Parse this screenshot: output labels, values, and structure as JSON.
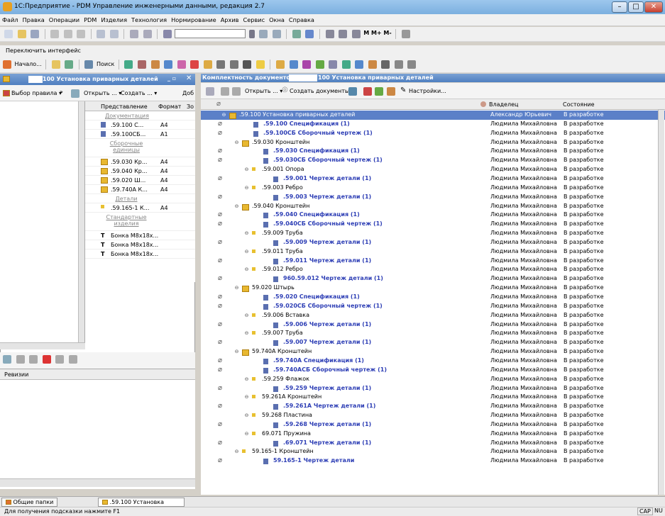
{
  "window": {
    "title": "1С:Предприятие - PDM Управление инженерными данными, редакция 2.7"
  },
  "menu": [
    "Файл",
    "Правка",
    "Операции",
    "PDM",
    "Изделия",
    "Технология",
    "Нормирование",
    "Архив",
    "Сервис",
    "Окна",
    "Справка"
  ],
  "toolbar2": {
    "m_labels": "M  M+  M-"
  },
  "interface_switch": "Переключить интерфейс",
  "toolbar3": {
    "start": "Начало...",
    "search": "Поиск"
  },
  "left_panel": {
    "title": "100 Установка приварных деталей",
    "rule_button": "Выбор правила",
    "open_button": "Открыть ...",
    "create_button": "Создать ...",
    "more_button": "Доб",
    "tree": [
      ".59.100",
      ".59",
      ".59",
      ".59.0",
      ".59.0",
      ".59",
      ".59.7"
    ],
    "grid_headers": [
      "Представление",
      "Формат",
      "Зо"
    ],
    "grid": [
      {
        "kind": "group",
        "text": "Документация"
      },
      {
        "kind": "doc",
        "text": ".59.100 С...",
        "fmt": "A4"
      },
      {
        "kind": "doc",
        "text": ".59.100СБ...",
        "fmt": "A1"
      },
      {
        "kind": "group",
        "text": "Сборочные единицы"
      },
      {
        "kind": "folder",
        "text": ".59.030 Кр...",
        "fmt": "A4"
      },
      {
        "kind": "folder",
        "text": ".59.040 Кр...",
        "fmt": "A4"
      },
      {
        "kind": "folder",
        "text": ".59.020 Ш...",
        "fmt": "A4"
      },
      {
        "kind": "folder",
        "text": ".59.740А К...",
        "fmt": "A4"
      },
      {
        "kind": "group",
        "text": "Детали"
      },
      {
        "kind": "part",
        "text": ".59.165-1 К...",
        "fmt": "A4"
      },
      {
        "kind": "group",
        "text": "Стандартные изделия"
      },
      {
        "kind": "std",
        "text": "Бонка М8х18х...",
        "fmt": ""
      },
      {
        "kind": "std",
        "text": "Бонка М8х18х...",
        "fmt": ""
      },
      {
        "kind": "std",
        "text": "Бонка М8х18х...",
        "fmt": ""
      }
    ],
    "revisions_header": "Ревизии"
  },
  "right_panel": {
    "title_prefix": "Комплектность документов:",
    "title_suffix": "100 Установка приварных деталей",
    "open_button": "Открыть ...",
    "create_docs": "Создать документы",
    "settings": "Настройки...",
    "col_owner": "Владелец",
    "col_state": "Состояние",
    "rows": [
      {
        "lvl": 0,
        "t": "folder",
        "clip": false,
        "sel": true,
        "name": ".59.100 Установка приварных деталей",
        "owner": "Александр Юрьевич",
        "state": "В разработке"
      },
      {
        "lvl": 1,
        "t": "doc",
        "clip": true,
        "name": ".59.100 Спецификация (1)",
        "owner": "Людмила Михайловна",
        "state": "В разработке"
      },
      {
        "lvl": 1,
        "t": "doc",
        "clip": true,
        "name": ".59.100СБ Сборочный чертеж (1)",
        "owner": "Людмила Михайловна",
        "state": "В разработке"
      },
      {
        "lvl": 1,
        "t": "folder",
        "clip": false,
        "name": ".59.030 Кронштейн",
        "owner": "Людмила Михайловна",
        "state": "В разработке"
      },
      {
        "lvl": 2,
        "t": "doc",
        "clip": true,
        "name": ".59.030 Спецификация (1)",
        "owner": "Людмила Михайловна",
        "state": "В разработке"
      },
      {
        "lvl": 2,
        "t": "doc",
        "clip": true,
        "name": ".59.030СБ Сборочный чертеж (1)",
        "owner": "Людмила Михайловна",
        "state": "В разработке"
      },
      {
        "lvl": 2,
        "t": "part",
        "clip": false,
        "name": ".59.001 Опора",
        "owner": "Людмила Михайловна",
        "state": "В разработке"
      },
      {
        "lvl": 3,
        "t": "doc",
        "clip": true,
        "name": ".59.001 Чертеж детали (1)",
        "owner": "Людмила Михайловна",
        "state": "В разработке"
      },
      {
        "lvl": 2,
        "t": "part",
        "clip": false,
        "name": ".59.003 Ребро",
        "owner": "Людмила Михайловна",
        "state": "В разработке"
      },
      {
        "lvl": 3,
        "t": "doc",
        "clip": true,
        "name": ".59.003 Чертеж детали (1)",
        "owner": "Людмила Михайловна",
        "state": "В разработке"
      },
      {
        "lvl": 1,
        "t": "folder",
        "clip": false,
        "name": ".59.040 Кронштейн",
        "owner": "Людмила Михайловна",
        "state": "В разработке"
      },
      {
        "lvl": 2,
        "t": "doc",
        "clip": true,
        "name": ".59.040 Спецификация (1)",
        "owner": "Людмила Михайловна",
        "state": "В разработке"
      },
      {
        "lvl": 2,
        "t": "doc",
        "clip": true,
        "name": ".59.040СБ Сборочный чертеж (1)",
        "owner": "Людмила Михайловна",
        "state": "В разработке"
      },
      {
        "lvl": 2,
        "t": "part",
        "clip": false,
        "name": ".59.009 Труба",
        "owner": "Людмила Михайловна",
        "state": "В разработке"
      },
      {
        "lvl": 3,
        "t": "doc",
        "clip": true,
        "name": ".59.009 Чертеж детали (1)",
        "owner": "Людмила Михайловна",
        "state": "В разработке"
      },
      {
        "lvl": 2,
        "t": "part",
        "clip": false,
        "name": ".59.011 Труба",
        "owner": "Людмила Михайловна",
        "state": "В разработке"
      },
      {
        "lvl": 3,
        "t": "doc",
        "clip": true,
        "name": ".59.011 Чертеж детали (1)",
        "owner": "Людмила Михайловна",
        "state": "В разработке"
      },
      {
        "lvl": 2,
        "t": "part",
        "clip": false,
        "name": ".59.012 Ребро",
        "owner": "Людмила Михайловна",
        "state": "В разработке"
      },
      {
        "lvl": 3,
        "t": "doc",
        "clip": true,
        "name": "960.59.012 Чертеж детали (1)",
        "owner": "Людмила Михайловна",
        "state": "В разработке"
      },
      {
        "lvl": 1,
        "t": "folder",
        "clip": false,
        "name": "59.020 Штырь",
        "owner": "Людмила Михайловна",
        "state": "В разработке"
      },
      {
        "lvl": 2,
        "t": "doc",
        "clip": true,
        "name": ".59.020 Спецификация (1)",
        "owner": "Людмила Михайловна",
        "state": "В разработке"
      },
      {
        "lvl": 2,
        "t": "doc",
        "clip": true,
        "name": ".59.020СБ Сборочный чертеж (1)",
        "owner": "Людмила Михайловна",
        "state": "В разработке"
      },
      {
        "lvl": 2,
        "t": "part",
        "clip": false,
        "name": ".59.006 Вставка",
        "owner": "Людмила Михайловна",
        "state": "В разработке"
      },
      {
        "lvl": 3,
        "t": "doc",
        "clip": true,
        "name": ".59.006 Чертеж детали (1)",
        "owner": "Людмила Михайловна",
        "state": "В разработке"
      },
      {
        "lvl": 2,
        "t": "part",
        "clip": false,
        "name": ".59.007 Труба",
        "owner": "Людмила Михайловна",
        "state": "В разработке"
      },
      {
        "lvl": 3,
        "t": "doc",
        "clip": true,
        "name": ".59.007 Чертеж детали (1)",
        "owner": "Людмила Михайловна",
        "state": "В разработке"
      },
      {
        "lvl": 1,
        "t": "folder",
        "clip": false,
        "name": "59.740А Кронштейн",
        "owner": "Людмила Михайловна",
        "state": "В разработке"
      },
      {
        "lvl": 2,
        "t": "doc",
        "clip": true,
        "name": ".59.740А Спецификация (1)",
        "owner": "Людмила Михайловна",
        "state": "В разработке"
      },
      {
        "lvl": 2,
        "t": "doc",
        "clip": true,
        "name": ".59.740АСБ Сборочный чертеж (1)",
        "owner": "Людмила Михайловна",
        "state": "В разработке"
      },
      {
        "lvl": 2,
        "t": "part",
        "clip": false,
        "name": ".59.259 Флажок",
        "owner": "Людмила Михайловна",
        "state": "В разработке"
      },
      {
        "lvl": 3,
        "t": "doc",
        "clip": true,
        "name": ".59.259 Чертеж детали (1)",
        "owner": "Людмила Михайловна",
        "state": "В разработке"
      },
      {
        "lvl": 2,
        "t": "part",
        "clip": false,
        "name": "59.261А Кронштейн",
        "owner": "Людмила Михайловна",
        "state": "В разработке"
      },
      {
        "lvl": 3,
        "t": "doc",
        "clip": true,
        "name": ".59.261А Чертеж детали (1)",
        "owner": "Людмила Михайловна",
        "state": "В разработке"
      },
      {
        "lvl": 2,
        "t": "part",
        "clip": false,
        "name": "59.268 Пластина",
        "owner": "Людмила Михайловна",
        "state": "В разработке"
      },
      {
        "lvl": 3,
        "t": "doc",
        "clip": true,
        "name": ".59.268 Чертеж детали (1)",
        "owner": "Людмила Михайловна",
        "state": "В разработке"
      },
      {
        "lvl": 2,
        "t": "part",
        "clip": false,
        "name": "69.071 Пружина",
        "owner": "Людмила Михайловна",
        "state": "В разработке"
      },
      {
        "lvl": 3,
        "t": "doc",
        "clip": true,
        "name": ".69.071 Чертеж детали (1)",
        "owner": "Людмила Михайловна",
        "state": "В разработке"
      },
      {
        "lvl": 1,
        "t": "part",
        "clip": false,
        "name": "59.165-1 Кронштейн",
        "owner": "Людмила Михайловна",
        "state": "В разработке"
      },
      {
        "lvl": 2,
        "t": "doc",
        "clip": true,
        "name": "59.165-1 Чертеж детали",
        "owner": "Людмила Михайловна",
        "state": "В разработке"
      }
    ]
  },
  "taskbar": {
    "tab1": "Общие папки",
    "tab2": ".59.100 Установка при..."
  },
  "status": {
    "hint": "Для получения подсказки нажмите F1",
    "cap": "CAP",
    "num": "NU"
  },
  "colors": {
    "accent": "#5b80c8",
    "link": "#2d3eb5"
  }
}
